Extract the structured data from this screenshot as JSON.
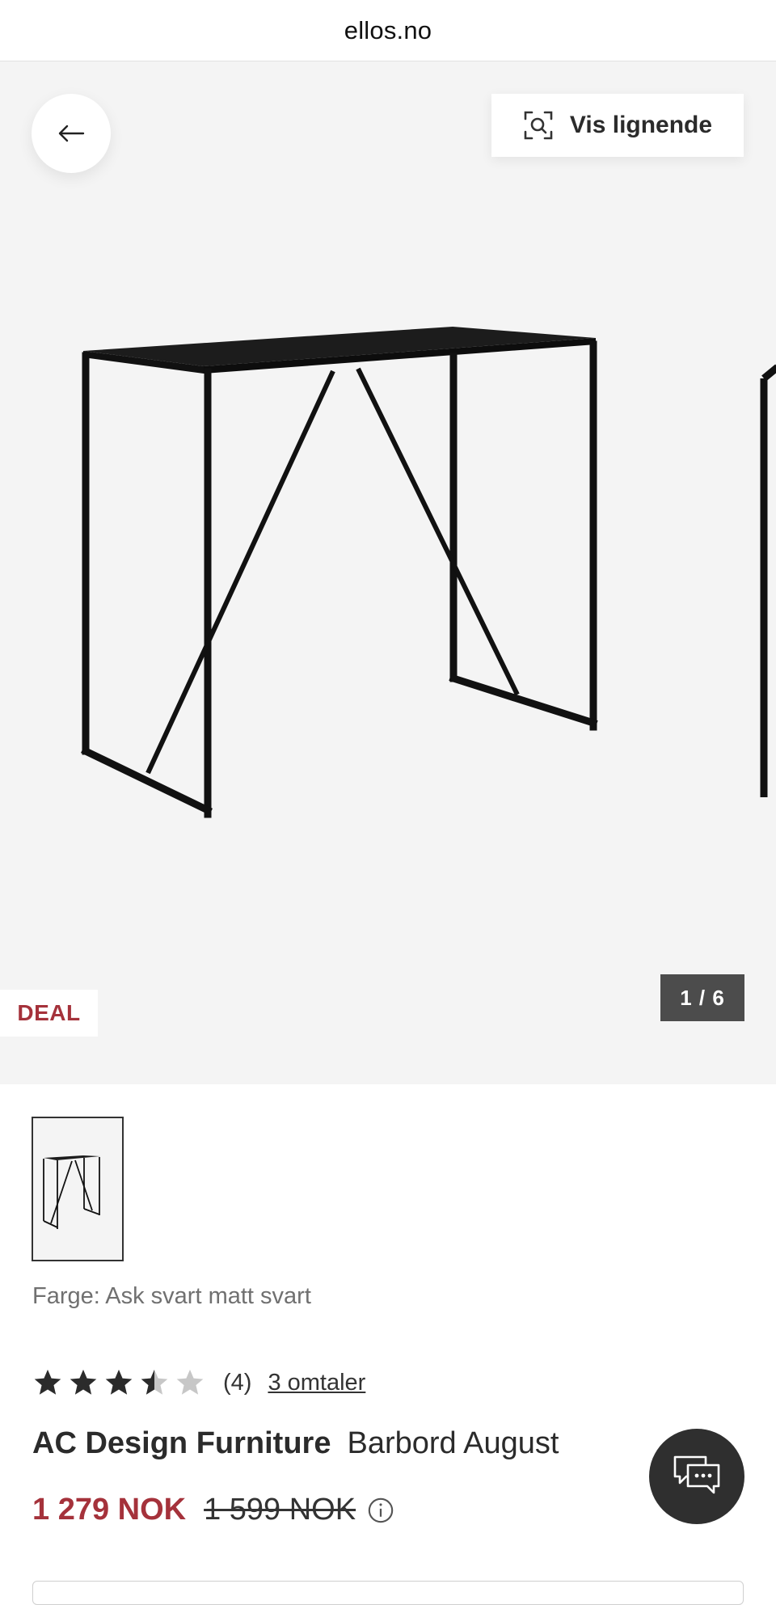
{
  "browser": {
    "url": "ellos.no"
  },
  "gallery": {
    "similar_label": "Vis lignende",
    "badge": "DEAL",
    "counter": "1 / 6",
    "current_image": 1,
    "total_images": 6
  },
  "product": {
    "color_label": "Farge: Ask svart matt svart",
    "rating": 3.5,
    "rating_max": 5,
    "rating_count": "(4)",
    "reviews_link": "3 omtaler",
    "brand": "AC Design Furniture",
    "name": "Barbord August",
    "price": "1 279 NOK",
    "old_price": "1 599 NOK"
  },
  "colors": {
    "accent": "#a5323b",
    "gallery_bg": "#f4f4f4",
    "counter_bg": "#4c4c4c",
    "chat_bg": "#2f2f2f"
  },
  "icons": [
    "arrow-left-icon",
    "visual-search-icon",
    "star-icon",
    "info-icon",
    "chat-icon"
  ]
}
